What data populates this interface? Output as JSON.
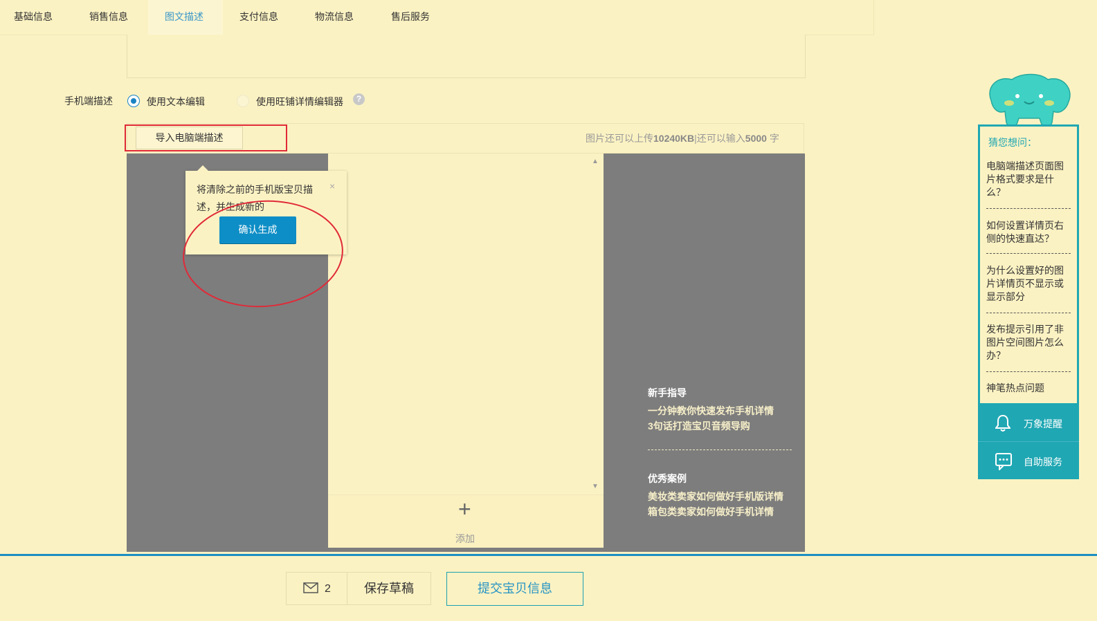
{
  "tabs": [
    {
      "label": "基础信息",
      "active": false
    },
    {
      "label": "销售信息",
      "active": false
    },
    {
      "label": "图文描述",
      "active": true
    },
    {
      "label": "支付信息",
      "active": false
    },
    {
      "label": "物流信息",
      "active": false
    },
    {
      "label": "售后服务",
      "active": false
    }
  ],
  "mobile_desc": {
    "label": "手机端描述",
    "option_text_editor": "使用文本编辑",
    "option_wangpu_editor": "使用旺铺详情编辑器",
    "selected": "使用文本编辑"
  },
  "toolbar": {
    "import_button": "导入电脑端描述",
    "limit_prefix": "图片还可以上传",
    "limit_image": "10240KB",
    "limit_middle": "|还可以输入",
    "limit_chars": "5000",
    "limit_suffix": " 字"
  },
  "popup": {
    "message": "将清除之前的手机版宝贝描述，并生成新的",
    "confirm": "确认生成",
    "close": "×"
  },
  "phone": {
    "add_plus": "+",
    "add_label": "添加"
  },
  "guide": {
    "beginner_title": "新手指导",
    "beginner_links": [
      "一分钟教你快速发布手机详情",
      "3句话打造宝贝音频导购"
    ],
    "cases_title": "优秀案例",
    "cases_links": [
      "美妆类卖家如何做好手机版详情",
      "箱包类卖家如何做好手机详情"
    ]
  },
  "help_widget": {
    "title": "猜您想问：",
    "questions": [
      "电脑端描述页面图片格式要求是什么？",
      "如何设置详情页右侧的快速直达？",
      "为什么设置好的图片详情页不显示或显示部分",
      "发布提示引用了非图片空间图片怎么办？",
      "神笔热点问题"
    ],
    "actions": [
      "万象提醒",
      "自助服务"
    ]
  },
  "bottom": {
    "mail_count": "2",
    "save_draft": "保存草稿",
    "submit": "提交宝贝信息"
  },
  "colors": {
    "background": "#fbf2c3",
    "accent_blue": "#0e8ec6",
    "teal": "#1fa7b3",
    "annotation_red": "#e02a38",
    "preview_gray": "#7d7d7d"
  }
}
